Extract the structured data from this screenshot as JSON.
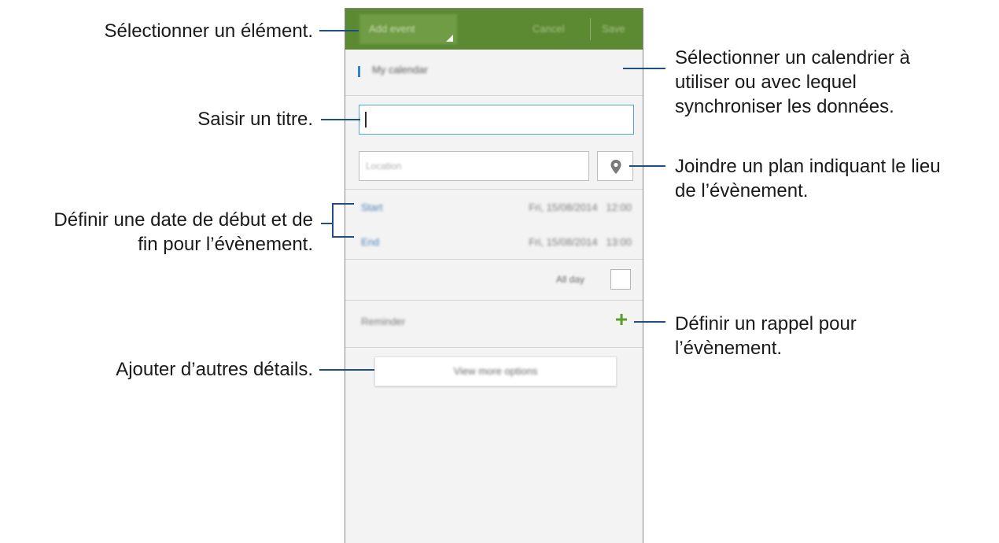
{
  "screen": {
    "actionbar": {
      "spinner_label": "Add event",
      "cancel_label": "Cancel",
      "save_label": "Save"
    },
    "calendar_label": "My calendar",
    "title_field": {
      "value": "",
      "placeholder": ""
    },
    "location_field": {
      "placeholder": "Location"
    },
    "start": {
      "label": "Start",
      "value": "Fri, 15/08/2014   12:00"
    },
    "end": {
      "label": "End",
      "value": "Fri, 15/08/2014   13:00"
    },
    "all_day_label": "All day",
    "reminder_label": "Reminder",
    "add_reminder_symbol": "+",
    "more_options_label": "View more options",
    "colors": {
      "actionbar": "#5c8a32",
      "accent_blue": "#2e88c8",
      "plus_green": "#5a9e2d"
    }
  },
  "callouts": {
    "select_item": "Sélectionner un élément.",
    "select_calendar": [
      "Sélectionner un calendrier à",
      "utiliser ou avec lequel",
      "synchroniser les données."
    ],
    "enter_title": "Saisir un titre.",
    "attach_map": [
      "Joindre un plan indiquant le lieu",
      "de l’évènement."
    ],
    "set_dates": [
      "Définir une date de début et de",
      "fin pour l’évènement."
    ],
    "set_reminder": [
      "Définir un rappel pour",
      "l’évènement."
    ],
    "add_details": "Ajouter d’autres détails."
  }
}
